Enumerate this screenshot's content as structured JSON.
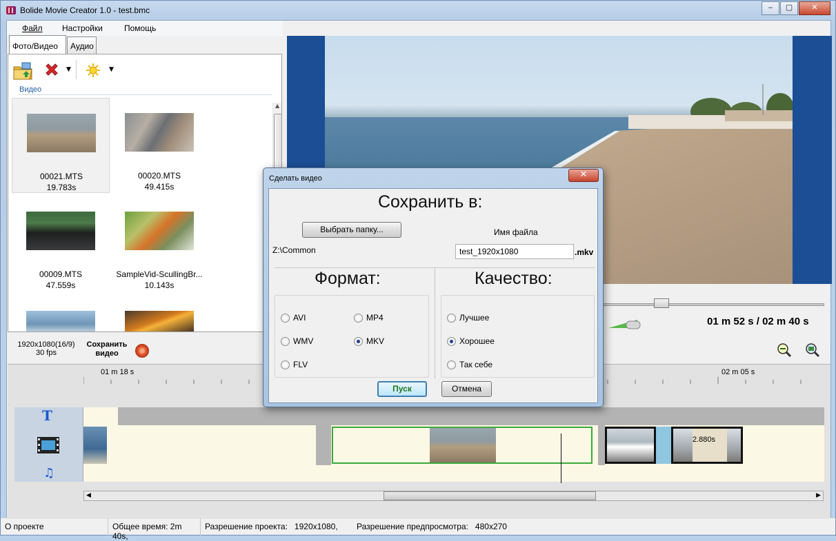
{
  "window": {
    "title": "Bolide Movie Creator 1.0 - test.bmc",
    "minimize": "‒",
    "maximize": "▢",
    "close": "✕"
  },
  "menu": [
    "Файл",
    "Настройки",
    "Помощь"
  ],
  "media_panel": {
    "tabs": [
      "Фото/Видео",
      "Аудио"
    ],
    "section": "Видео",
    "items": [
      {
        "name": "00021.MTS",
        "duration": "19.783s"
      },
      {
        "name": "00020.MTS",
        "duration": "49.415s"
      },
      {
        "name": "00009.MTS",
        "duration": "47.559s"
      },
      {
        "name": "SampleVid-ScullingBr...",
        "duration": "10.143s"
      }
    ]
  },
  "preview": {
    "current_time": "01 m 52 s",
    "total_time": "/ 02 m 40 s"
  },
  "project": {
    "resolution": "1920x1080(16/9)",
    "fps": "30 fps",
    "save_line1": "Сохранить",
    "save_line2": "видео"
  },
  "timeline": {
    "ruler": [
      "01 m 18 s",
      "02 m 05 s"
    ],
    "clip_label": "2.880s"
  },
  "status": {
    "about": "О проекте",
    "total_time": "Общее время: 2m 40s,",
    "project_res_label": "Разрешение проекта:",
    "project_res": "1920x1080,",
    "preview_res_label": "Разрешение предпросмотра:",
    "preview_res": "480x270"
  },
  "dialog": {
    "title": "Сделать видео",
    "close": "✕",
    "save_to": "Сохранить в:",
    "choose_folder": "Выбрать папку...",
    "folder_path": "Z:\\Common",
    "filename_label": "Имя файла",
    "filename": "test_1920x1080",
    "extension": ".mkv",
    "format_heading": "Формат:",
    "quality_heading": "Качество:",
    "formats": [
      "AVI",
      "MP4",
      "WMV",
      "MKV",
      "FLV"
    ],
    "selected_format": "MKV",
    "qualities": [
      "Лучшее",
      "Хорошее",
      "Так себе"
    ],
    "selected_quality": "Хорошее",
    "start": "Пуск",
    "cancel": "Отмена"
  }
}
